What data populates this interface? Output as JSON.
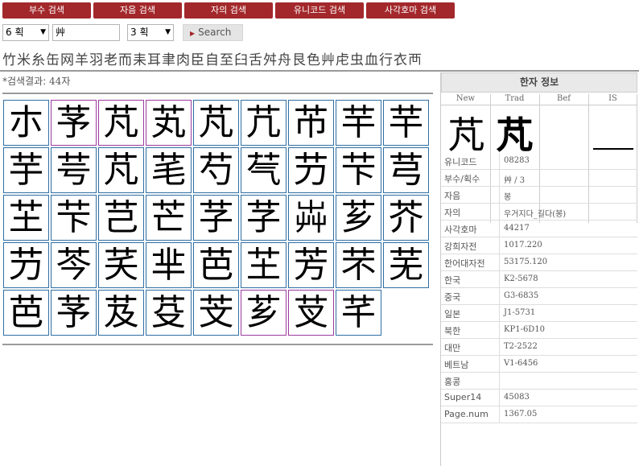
{
  "tabs": [
    "부수 검색",
    "자음 검색",
    "자의 검색",
    "유니코드 검색",
    "사각호마 검색"
  ],
  "search": {
    "stroke_select": "6 획",
    "radical_input": "艸",
    "extra_select": "3 획",
    "button_label": "Search"
  },
  "radicals": "竹米糸缶网羊羽老而耒耳聿肉臣自至臼舌舛舟艮色艸虍虫血行衣襾",
  "result": {
    "prefix": "*검색결과:",
    "count": "44자"
  },
  "chars": [
    "朩",
    "芧",
    "芃",
    "芄",
    "芃",
    "芁",
    "芇",
    "芉",
    "芉",
    "芋",
    "芌",
    "芃",
    "芼",
    "芍",
    "芞",
    "芀",
    "芐",
    "芎",
    "芏",
    "芐",
    "芑",
    "芒",
    "芓",
    "芓",
    "芔",
    "芗",
    "芥",
    "芀",
    "芩",
    "芺",
    "芈",
    "芭",
    "芏",
    "芳",
    "芣",
    "芜",
    "芭",
    "芧",
    "芨",
    "芟",
    "芠",
    "芗",
    "芆",
    "芊"
  ],
  "purple_cells": [
    1,
    2,
    3,
    41,
    42,
    49
  ],
  "panel": {
    "title": "한자 정보",
    "headers": [
      "New",
      "Trad",
      "Bef",
      "IS"
    ],
    "glyph_new": "芃",
    "glyph_trad": "芃",
    "rows": [
      {
        "k": "유니코드",
        "v": "08283"
      },
      {
        "k": "부수/획수",
        "v": "艸 / 3"
      },
      {
        "k": "자음",
        "v": "봉"
      },
      {
        "k": "자의",
        "v": "우거지다_길다(봉)"
      },
      {
        "k": "사각호마",
        "v": "44217"
      },
      {
        "k": "강희자전",
        "v": "1017.220"
      },
      {
        "k": "한어대자전",
        "v": "53175.120"
      },
      {
        "k": "한국",
        "v": "K2-5678"
      },
      {
        "k": "중국",
        "v": "G3-6835"
      },
      {
        "k": "일본",
        "v": "J1-5731"
      },
      {
        "k": "북한",
        "v": "KP1-6D10"
      },
      {
        "k": "대만",
        "v": "T2-2522"
      },
      {
        "k": "베트남",
        "v": "V1-6456"
      },
      {
        "k": "홍콩",
        "v": ""
      },
      {
        "k": "Super14",
        "v": "45083"
      },
      {
        "k": "Page.num",
        "v": "1367.05"
      }
    ]
  }
}
